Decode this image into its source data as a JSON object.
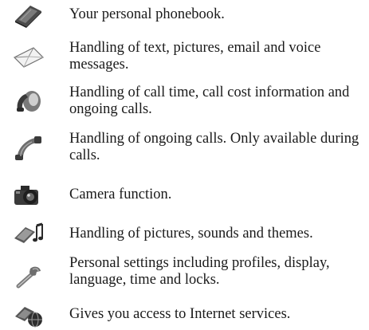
{
  "items": [
    {
      "icon": "phonebook-icon",
      "text": "Your personal phonebook."
    },
    {
      "icon": "envelope-icon",
      "text": "Handling of text, pictures, email and voice messages."
    },
    {
      "icon": "call-info-icon",
      "text": "Handling of call time, call cost information and ongoing calls."
    },
    {
      "icon": "phone-handset-icon",
      "text": "Handling of ongoing calls. Only available during calls."
    },
    {
      "icon": "camera-icon",
      "text": "Camera function."
    },
    {
      "icon": "media-icon",
      "text": "Handling of pictures, sounds and themes."
    },
    {
      "icon": "wrench-icon",
      "text": "Personal settings including profiles, display, language, time and locks."
    },
    {
      "icon": "internet-icon",
      "text": "Gives you access to Internet services."
    }
  ]
}
